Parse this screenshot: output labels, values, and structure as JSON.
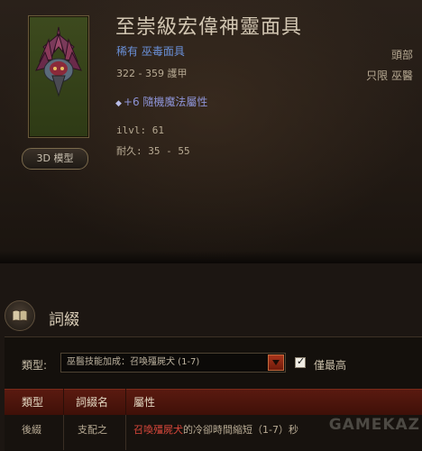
{
  "item": {
    "name": "至崇級宏偉神靈面具",
    "rarity_type": "稀有 巫毒面具",
    "armor": "322 - 359 護甲",
    "slot": "頭部",
    "class_restriction": "只限 巫醫",
    "random_affix": "+6 隨機魔法屬性",
    "ilvl": "ilvl: 61",
    "durability": "耐久: 35 - 55",
    "model_button": "3D 模型"
  },
  "affix_section": {
    "title": "詞綴",
    "filter_label": "類型:",
    "selected_filter": "巫醫技能加成：召喚殭屍犬 (1-7)",
    "checkbox_label": "僅最高",
    "checkbox_checked": true
  },
  "table": {
    "headers": [
      "類型",
      "詞綴名",
      "屬性"
    ],
    "rows": [
      {
        "type": "後綴",
        "name": "支配之",
        "prop_highlight": "召喚殭屍犬",
        "prop_rest": "的冷卻時間縮短（1-7）秒"
      }
    ]
  },
  "watermark": "GAMEKAZ",
  "colors": {
    "rarity": "#6a90d8",
    "affix": "#8d93d6",
    "highlight": "#d9473b",
    "header_bg": "#5a1a10"
  }
}
